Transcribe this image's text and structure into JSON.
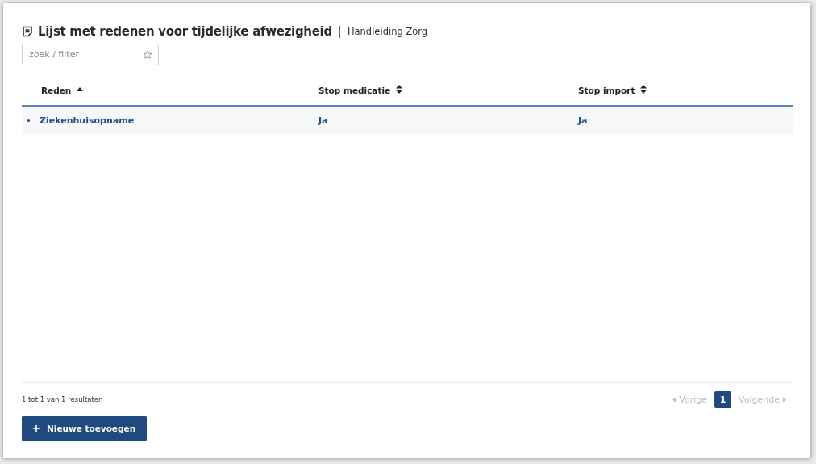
{
  "header": {
    "title": "Lijst met redenen voor tijdelijke afwezigheid",
    "subtitle": "Handleiding Zorg"
  },
  "search": {
    "placeholder": "zoek / filter"
  },
  "table": {
    "columns": [
      {
        "label": "Reden",
        "sorted": true
      },
      {
        "label": "Stop medicatie",
        "sorted": false
      },
      {
        "label": "Stop import",
        "sorted": false
      }
    ],
    "rows": [
      {
        "cells": [
          "Ziekenhuisopname",
          "Ja",
          "Ja"
        ]
      }
    ]
  },
  "footer": {
    "summary": "1 tot 1 van 1 resultaten",
    "pagination": {
      "previous": {
        "label": "Vorige",
        "disabled": true
      },
      "pages": [
        {
          "label": "1",
          "selected": true
        }
      ],
      "next": {
        "label": "Volgende",
        "disabled": true
      }
    },
    "add_button": "Nieuwe toevoegen"
  }
}
